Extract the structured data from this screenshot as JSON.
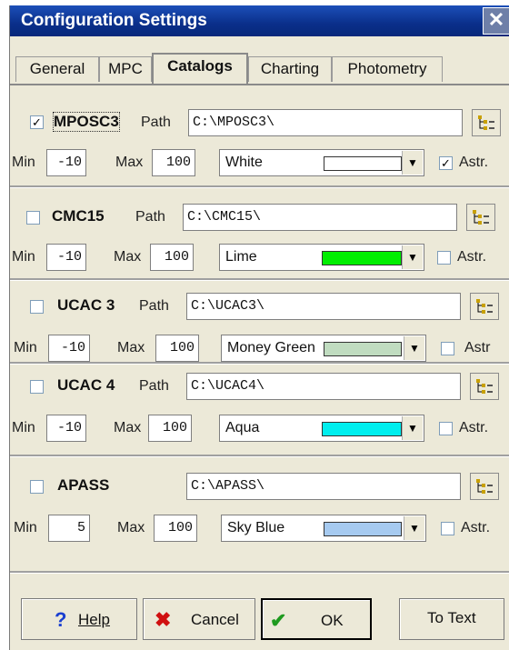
{
  "window": {
    "title": "Configuration Settings"
  },
  "tabs": [
    "General",
    "MPC",
    "Catalogs",
    "Charting",
    "Photometry"
  ],
  "labels": {
    "path": "Path",
    "min": "Min",
    "max": "Max",
    "astr": "Astr.",
    "astr_short": "Astr"
  },
  "catalogs": [
    {
      "name": "MPOSC3",
      "checked": true,
      "path": "C:\\MPOSC3\\",
      "min": "-10",
      "max": "100",
      "color_name": "White",
      "swatch": "#ffffff",
      "astr_checked": true
    },
    {
      "name": "CMC15",
      "checked": false,
      "path": "C:\\CMC15\\",
      "min": "-10",
      "max": "100",
      "color_name": "Lime",
      "swatch": "#00ee00",
      "astr_checked": false
    },
    {
      "name": "UCAC 3",
      "checked": false,
      "path": "C:\\UCAC3\\",
      "min": "-10",
      "max": "100",
      "color_name": "Money Green",
      "swatch": "#c0dcc0",
      "astr_checked": false
    },
    {
      "name": "UCAC 4",
      "checked": false,
      "path": "C:\\UCAC4\\",
      "min": "-10",
      "max": "100",
      "color_name": "Aqua",
      "swatch": "#00eeee",
      "astr_checked": false
    },
    {
      "name": "APASS",
      "checked": false,
      "path": "C:\\APASS\\",
      "min": "5",
      "max": "100",
      "color_name": "Sky Blue",
      "swatch": "#a6caf0",
      "astr_checked": false
    }
  ],
  "buttons": {
    "help": "Help",
    "cancel": "Cancel",
    "ok": "OK",
    "to_text": "To Text"
  }
}
